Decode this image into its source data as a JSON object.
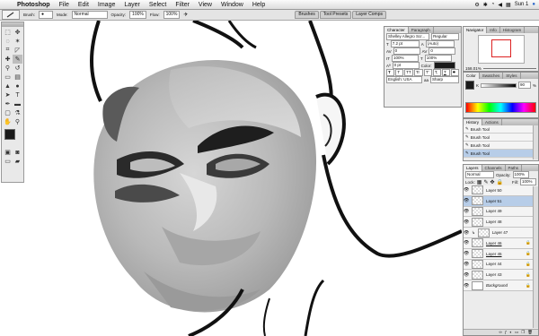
{
  "menubar": {
    "app": "Photoshop",
    "items": [
      "File",
      "Edit",
      "Image",
      "Layer",
      "Select",
      "Filter",
      "View",
      "Window",
      "Help"
    ],
    "status": "Sun 1"
  },
  "options": {
    "brush_label": "Brush:",
    "mode_label": "Mode:",
    "mode_value": "Normal",
    "opacity_label": "Opacity:",
    "opacity_value": "100%",
    "flow_label": "Flow:",
    "flow_value": "100%",
    "wells": [
      "Brushes",
      "Tool Presets",
      "Layer Comps"
    ]
  },
  "character": {
    "tabs": [
      "Character",
      "Paragraph"
    ],
    "font": "Shelley Allegro Scr...",
    "style": "Regular",
    "size": "7.2 pt",
    "leading": "(Auto)",
    "kerning": "0",
    "tracking": "0",
    "vscale": "100%",
    "hscale": "100%",
    "baseline": "0 pt",
    "color_label": "Color:",
    "type_buttons": [
      "T",
      "T",
      "TT",
      "Tr",
      "T'",
      "T,",
      "T",
      "T"
    ],
    "language": "English: USA",
    "aa": "Sharp"
  },
  "navigator": {
    "tabs": [
      "Navigator",
      "Info",
      "Histogram"
    ],
    "zoom": "158.01%"
  },
  "color_panel": {
    "tabs": [
      "Color",
      "Swatches",
      "Styles"
    ],
    "k_label": "K",
    "k_value": "90",
    "pct": "%"
  },
  "history": {
    "tabs": [
      "History",
      "Actions"
    ],
    "items": [
      "Brush Tool",
      "Brush Tool",
      "Brush Tool",
      "Brush Tool"
    ]
  },
  "layers": {
    "tabs": [
      "Layers",
      "Channels",
      "Paths"
    ],
    "blend": "Normal",
    "opacity_label": "Opacity:",
    "opacity_value": "100%",
    "lock_label": "Lock:",
    "fill_label": "Fill:",
    "fill_value": "100%",
    "items": [
      "Layer 50",
      "Layer 51",
      "Layer 49",
      "Layer 48",
      "Layer 47",
      "Layer 46",
      "Layer 45",
      "Layer 44",
      "Layer 43",
      "Background"
    ]
  },
  "colors": {
    "accent": "#b7cde8",
    "foreground": "#1a1a1a",
    "background": "#ffffff"
  }
}
